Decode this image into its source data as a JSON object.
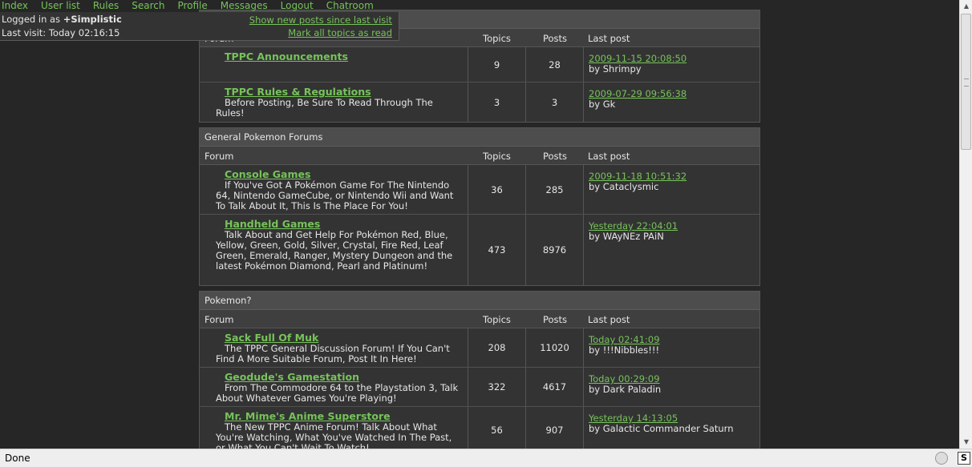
{
  "nav": [
    "Index",
    "User list",
    "Rules",
    "Search",
    "Profile",
    "Messages",
    "Logout",
    "Chatroom"
  ],
  "user": {
    "logged_in_prefix": "Logged in as",
    "username": "+Simplistic",
    "last_visit": "Last visit: Today 02:16:15",
    "show_new": "Show new posts since last visit",
    "mark_read": "Mark all topics as read"
  },
  "columns": {
    "forum": "Forum",
    "topics": "Topics",
    "posts": "Posts",
    "last_post": "Last post"
  },
  "categories": [
    {
      "title": "",
      "forums": [
        {
          "name": "TPPC Announcements",
          "desc": "",
          "topics": "9",
          "posts": "28",
          "last_date": "2009-11-15 20:08:50",
          "last_by": "by Shrimpy"
        },
        {
          "name": "TPPC Rules & Regulations",
          "desc": "Before Posting, Be Sure To Read Through The Rules!",
          "topics": "3",
          "posts": "3",
          "last_date": "2009-07-29 09:56:38",
          "last_by": "by Gk"
        }
      ]
    },
    {
      "title": "General Pokemon Forums",
      "forums": [
        {
          "name": "Console Games",
          "desc": "If You've Got A Pokémon Game For The Nintendo 64, Nintendo GameCube, or Nintendo Wii and Want To Talk About It, This Is The Place For You!",
          "topics": "36",
          "posts": "285",
          "last_date": "2009-11-18 10:51:32",
          "last_by": "by Cataclysmic"
        },
        {
          "name": "Handheld Games",
          "desc": "Talk About and Get Help For Pokémon Red, Blue, Yellow, Green, Gold, Silver, Crystal, Fire Red, Leaf Green, Emerald, Ranger, Mystery Dungeon and the latest Pokémon Diamond, Pearl and Platinum!",
          "topics": "473",
          "posts": "8976",
          "last_date": "Yesterday 22:04:01",
          "last_by": "by WAyNEz PAiN"
        }
      ]
    },
    {
      "title": "Pokemon?",
      "forums": [
        {
          "name": "Sack Full Of Muk",
          "desc": "The TPPC General Discussion Forum! If You Can't Find A More Suitable Forum, Post It In Here!",
          "topics": "208",
          "posts": "11020",
          "last_date": "Today 02:41:09",
          "last_by": "by !!!Nibbles!!!"
        },
        {
          "name": "Geodude's Gamestation",
          "desc": "From The Commodore 64 to the Playstation 3, Talk About Whatever Games You're Playing!",
          "topics": "322",
          "posts": "4617",
          "last_date": "Today 00:29:09",
          "last_by": "by Dark Paladin"
        },
        {
          "name": "Mr. Mime's Anime Superstore",
          "desc": "The New TPPC Anime Forum! Talk About What You're Watching, What You've Watched In The Past, or What You Can't Wait To Watch!",
          "topics": "56",
          "posts": "907",
          "last_date": "Yesterday 14:13:05",
          "last_by": "by Galactic Commander Saturn"
        }
      ]
    }
  ],
  "status": {
    "text": "Done"
  },
  "colors": {
    "link": "#76c35a",
    "background": "#262626",
    "panel": "#333333",
    "header": "#4d4d4d"
  }
}
